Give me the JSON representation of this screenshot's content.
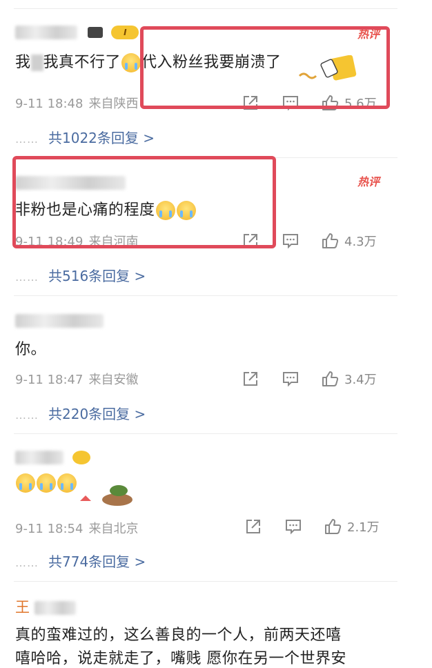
{
  "comments": [
    {
      "user": "",
      "badge": "I",
      "hot_label": "热评",
      "text_a": "我",
      "text_b": "我真不行了",
      "text_c": "代入粉丝我要崩溃了",
      "date": "9-11 18:48",
      "location": "来自陕西",
      "likes": "5.6万",
      "replies": "共1022条回复 >"
    },
    {
      "user": "",
      "hot_label": "热评",
      "text": "非粉也是心痛的程度",
      "date": "9-11 18:49",
      "location": "来自河南",
      "likes": "4.3万",
      "replies": "共516条回复 >"
    },
    {
      "user": "",
      "text": "你。",
      "date": "9-11 18:47",
      "location": "来自安徽",
      "likes": "3.4万",
      "replies": "共220条回复 >"
    },
    {
      "user": "",
      "date": "9-11 18:54",
      "location": "来自北京",
      "likes": "2.1万",
      "replies": "共774条回复 >"
    },
    {
      "user": "王",
      "text_line1": "真的蛮难过的，这么善良的一个人，前两天还嘻",
      "text_line2": "嘻哈哈，说走就走了，嘴贱 愿你在另一个世界安"
    }
  ],
  "reply_dots": "……",
  "icons": [
    "share-icon",
    "comment-icon",
    "like-icon",
    "crying-emoji",
    "thumbs-up-sticker",
    "capybara-sticker"
  ],
  "colors": {
    "highlight": "#e04a5a",
    "hot": "#e8534d",
    "reply_link": "#4a6ba0",
    "username": "#e0752a"
  }
}
